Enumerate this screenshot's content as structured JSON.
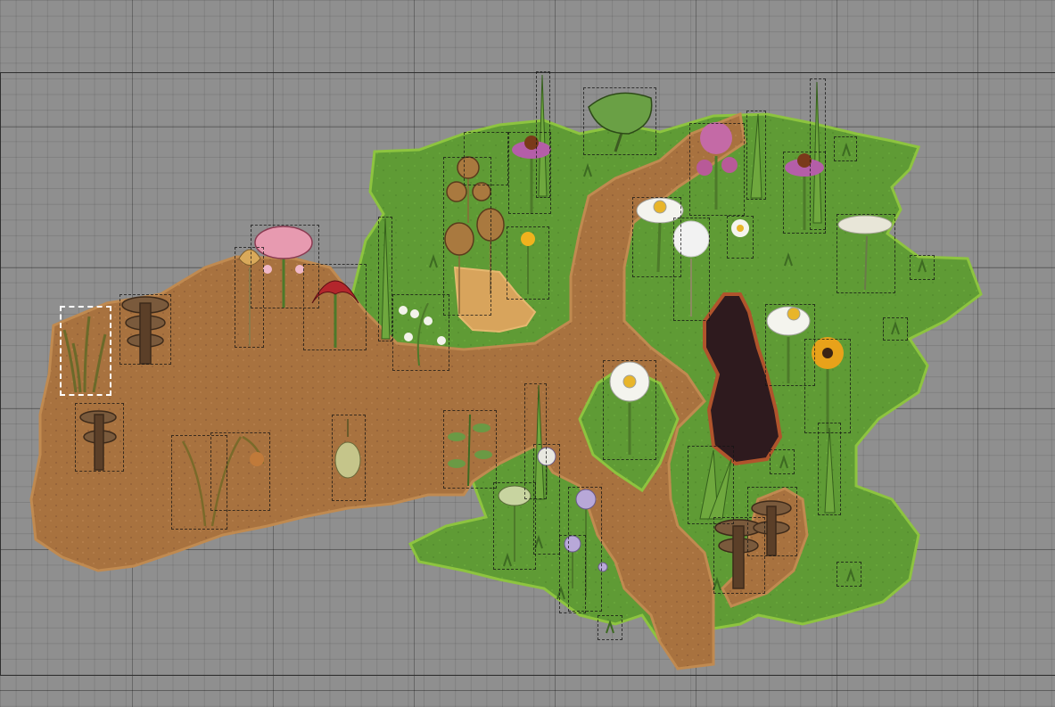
{
  "scene": {
    "colors": {
      "canvas": "#8f8f8f",
      "grass": "#5f9b35",
      "grass_edge": "#8dc43f",
      "dirt": "#a8723f",
      "dirt_edge": "#c08a50",
      "sand": "#d8a45c",
      "pit": "#2e1a1e",
      "pit_edge": "#b0542c"
    },
    "sprites": [
      {
        "kind": "reed-grass",
        "icon": "reed-grass-icon",
        "selected": true
      },
      {
        "kind": "bracket-mushroom",
        "icon": "mushroom-icon"
      },
      {
        "kind": "bracket-mushroom",
        "icon": "mushroom-icon"
      },
      {
        "kind": "pink-bell-flower",
        "icon": "flower-icon"
      },
      {
        "kind": "crocus",
        "icon": "flower-icon"
      },
      {
        "kind": "red-lily",
        "icon": "flower-icon"
      },
      {
        "kind": "tall-grass",
        "icon": "grass-icon"
      },
      {
        "kind": "lily-of-the-valley",
        "icon": "flower-icon"
      },
      {
        "kind": "poppy-seed-pods",
        "icon": "seed-pod-icon"
      },
      {
        "kind": "coneflower",
        "icon": "flower-icon"
      },
      {
        "kind": "elephant-ear-leaf",
        "icon": "leaf-icon"
      },
      {
        "kind": "dandelion",
        "icon": "flower-icon"
      },
      {
        "kind": "oxeye-daisy",
        "icon": "flower-icon"
      },
      {
        "kind": "dandelion-puff",
        "icon": "flower-icon"
      },
      {
        "kind": "valerian",
        "icon": "flower-icon"
      },
      {
        "kind": "coneflower",
        "icon": "flower-icon"
      },
      {
        "kind": "queen-annes-lace",
        "icon": "flower-icon"
      },
      {
        "kind": "dark-pit",
        "icon": "pit-icon"
      },
      {
        "kind": "daisy",
        "icon": "flower-icon"
      },
      {
        "kind": "black-eyed-susan",
        "icon": "flower-icon"
      },
      {
        "kind": "wilted-plant",
        "icon": "plant-icon"
      },
      {
        "kind": "seed-pod",
        "icon": "seed-pod-icon"
      },
      {
        "kind": "herb-sprig",
        "icon": "leaf-icon"
      },
      {
        "kind": "allium",
        "icon": "flower-icon"
      },
      {
        "kind": "grass-tuft",
        "icon": "grass-icon"
      }
    ]
  }
}
